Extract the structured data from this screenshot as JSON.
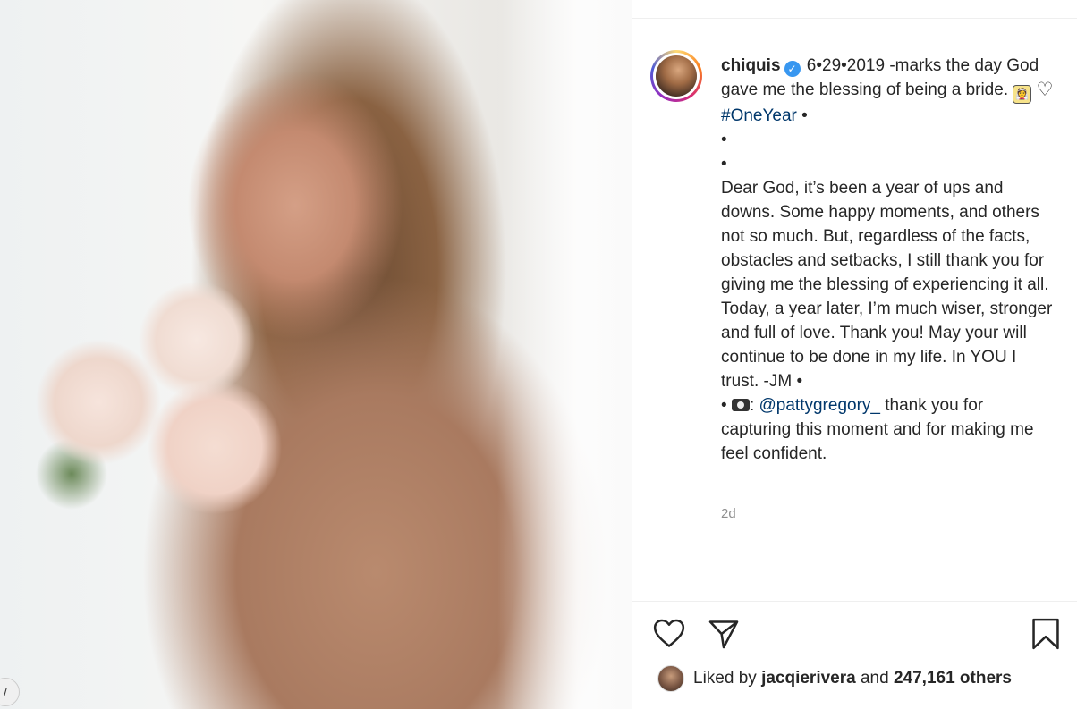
{
  "post": {
    "username": "chiquis",
    "verified_icon": "verified-badge-icon",
    "caption": {
      "line1": "6•29•2019 -marks the day God gave me the blessing of being a bride.",
      "hashtag": "#OneYear",
      "after_hashtag": "•",
      "bullet1": "•",
      "bullet2": "•",
      "body": "Dear God, it’s been a year of ups and downs. Some happy moments, and others not so much. But, regardless of the facts, obstacles and setbacks, I still thank you for giving me the blessing of experiencing it all. Today, a year later, I’m much wiser, stronger and full of love. Thank you! May your will continue to be done in my life. In YOU I trust. -JM •",
      "credit_prefix": "•",
      "credit_colon": ":",
      "mention": "@pattygregory_",
      "credit_text": "thank you for capturing this moment and for making me feel confident."
    },
    "time_ago": "2d",
    "likes": {
      "prefix": "Liked by",
      "liker": "jacqierivera",
      "and": "and",
      "others": "247,161 others"
    },
    "photo_corner_glyph": "/"
  },
  "colors": {
    "link": "#00376b",
    "verified": "#3897f0",
    "muted": "#8e8e8e",
    "text": "#262626"
  }
}
